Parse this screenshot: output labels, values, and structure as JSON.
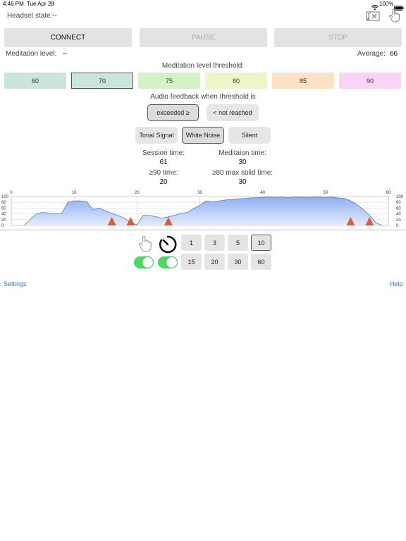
{
  "status_bar": {
    "time": "4:46 PM",
    "date": "Tue Apr 28",
    "battery": "100%"
  },
  "header": {
    "headset_label": "Headset state:",
    "headset_value": "--"
  },
  "controls": {
    "connect": "CONNECT",
    "pause": "PAUSE",
    "stop": "STOP"
  },
  "meditation": {
    "level_label": "Meditation level:",
    "level_value": "--",
    "average_label": "Average:",
    "average_value": "66"
  },
  "threshold": {
    "title": "Meditation level threshold:",
    "options": [
      {
        "label": "60",
        "color": "#c8e6dc"
      },
      {
        "label": "70",
        "color": "#c8e6dc"
      },
      {
        "label": "75",
        "color": "#d3f2c8"
      },
      {
        "label": "80",
        "color": "#eef6c9"
      },
      {
        "label": "85",
        "color": "#fde2c4"
      },
      {
        "label": "90",
        "color": "#fbd3f5"
      }
    ],
    "selected": "70"
  },
  "feedback": {
    "title": "Audio feedback when threshold is",
    "exceeded": "exceeded ≥",
    "not_reached": "< not reached",
    "tonal": "Tonal Signal",
    "white_noise": "White Noise",
    "silent": "Silent"
  },
  "stats": {
    "session_label": "Session time:",
    "session_value": "61",
    "med_time_label": "Meditaion time:",
    "med_time_value": "30",
    "ge90_label": "≥90 time:",
    "ge90_value": "20",
    "ge80_label": "≥80 max solid time:",
    "ge80_value": "30"
  },
  "chart_data": {
    "type": "area",
    "x_ticks": [
      "0",
      "10",
      "20",
      "30",
      "40",
      "50",
      "60"
    ],
    "y_ticks": [
      "100",
      "80",
      "60",
      "40",
      "20",
      "0"
    ],
    "xlim": [
      0,
      60
    ],
    "ylim": [
      0,
      100
    ],
    "x": [
      2,
      4,
      5,
      7,
      8,
      9,
      10,
      11,
      12,
      13,
      14,
      15,
      16,
      17,
      18,
      19,
      20,
      21,
      22,
      23,
      24,
      25,
      26,
      27,
      28,
      29,
      30,
      31,
      32,
      33,
      34,
      35,
      36,
      37,
      38,
      39,
      40,
      41,
      42,
      43,
      44,
      45,
      46,
      47,
      48,
      49,
      50,
      51,
      52,
      53,
      54,
      55,
      56,
      57,
      58,
      59
    ],
    "y": [
      0,
      40,
      45,
      40,
      40,
      80,
      85,
      85,
      82,
      55,
      60,
      50,
      42,
      34,
      25,
      10,
      2,
      35,
      35,
      30,
      25,
      30,
      35,
      42,
      45,
      58,
      70,
      85,
      82,
      84,
      88,
      90,
      92,
      93,
      95,
      96,
      97,
      98,
      97,
      98,
      96,
      98,
      98,
      97,
      98,
      98,
      97,
      98,
      95,
      94,
      85,
      72,
      55,
      35,
      10,
      0
    ],
    "markers_x": [
      16,
      19,
      25,
      54,
      57
    ],
    "marker_color": "#e05a3a",
    "fill_color": "#8fb0f0"
  },
  "timer": {
    "toggle1_on": true,
    "toggle2_on": true,
    "buttons_row1": [
      "1",
      "3",
      "5",
      "10"
    ],
    "buttons_row2": [
      "15",
      "20",
      "30",
      "60"
    ],
    "selected": "10"
  },
  "footer": {
    "settings": "Settings",
    "help": "Help"
  }
}
